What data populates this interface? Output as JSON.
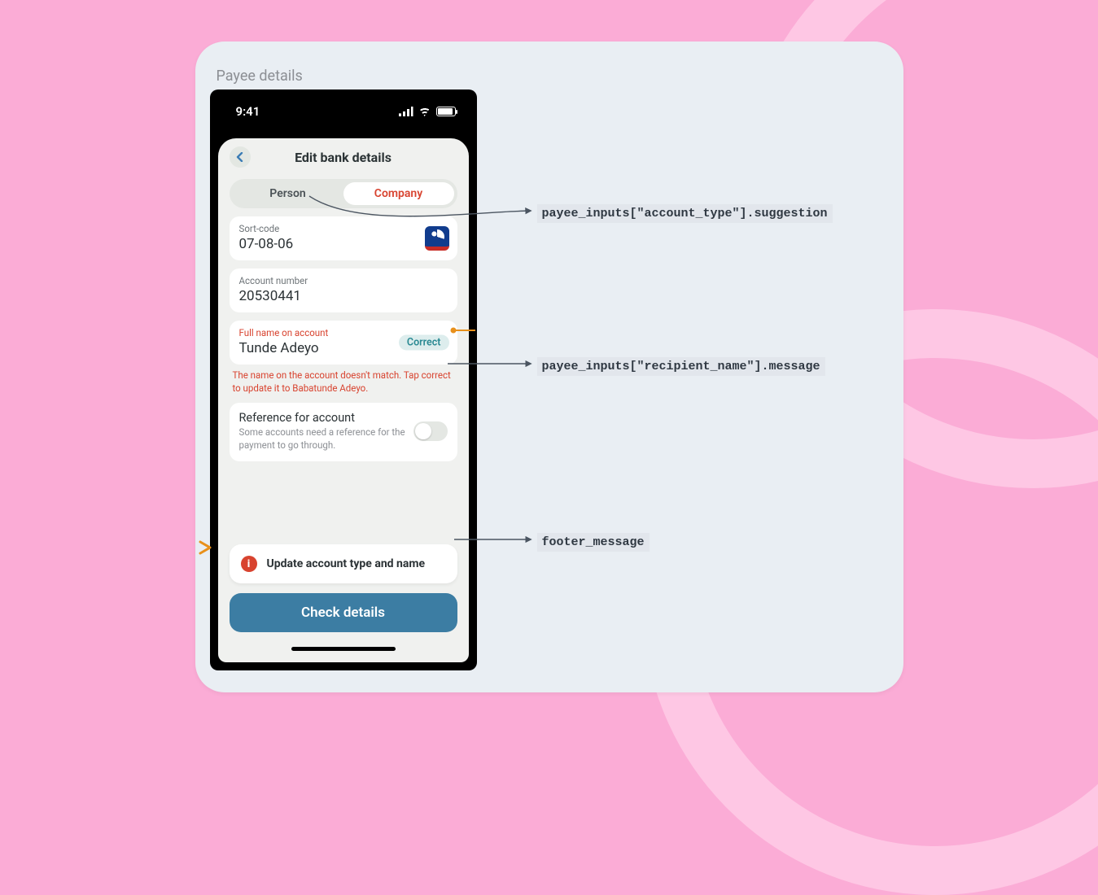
{
  "phone": {
    "overlay_label": "Payee details",
    "status_time": "9:41",
    "header_title": "Edit bank details",
    "segments": {
      "person": "Person",
      "company": "Company"
    },
    "sort_code": {
      "label": "Sort-code",
      "value": "07-08-06"
    },
    "account_number": {
      "label": "Account number",
      "value": "20530441"
    },
    "full_name": {
      "label": "Full name on account",
      "value": "Tunde Adeyo",
      "correct_button": "Correct",
      "error_message": "The name on the account doesn't match. Tap correct to update it to Babatunde Adeyo."
    },
    "reference": {
      "title": "Reference for account",
      "subtitle": "Some accounts need a reference for the payment to go through."
    },
    "footer_warning": "Update account type and name",
    "primary_button": "Check details"
  },
  "annotations": {
    "account_type_suggestion": "payee_inputs[\"account_type\"].suggestion",
    "recipient_name_message": "payee_inputs[\"recipient_name\"].message",
    "footer_message": "footer_message"
  }
}
